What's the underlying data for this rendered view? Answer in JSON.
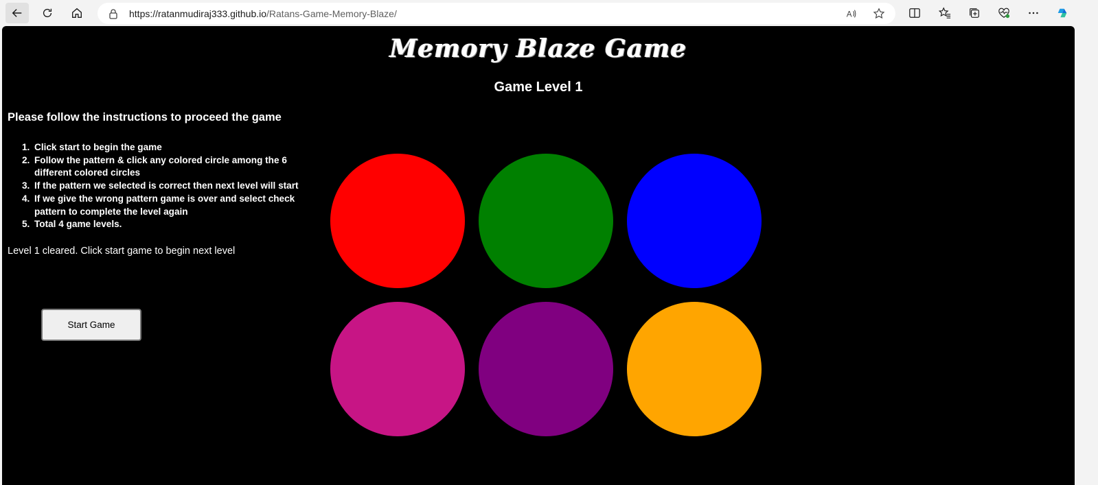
{
  "browser": {
    "url_host": "https://ratanmudiraj333.github.io",
    "url_path": "/Ratans-Game-Memory-Blaze/"
  },
  "page": {
    "title": "Memory Blaze Game",
    "level_heading": "Game Level 1",
    "instructions_heading": "Please follow the instructions to proceed the game",
    "instructions": [
      {
        "num": "1.",
        "text": "Click start to begin the game"
      },
      {
        "num": "2.",
        "text": "Follow the pattern & click any colored circle among the 6 different colored circles"
      },
      {
        "num": "3.",
        "text": "If the pattern we selected is correct then next level will start"
      },
      {
        "num": "4.",
        "text": "If we give the wrong pattern game is over and select check pattern to complete the level again"
      },
      {
        "num": "5.",
        "text": "Total 4 game levels."
      }
    ],
    "status_message": "Level 1 cleared. Click start game to begin next level",
    "start_button_label": "Start Game"
  },
  "circles": [
    {
      "name": "red",
      "color": "#ff0000"
    },
    {
      "name": "green",
      "color": "#008000"
    },
    {
      "name": "blue",
      "color": "#0000ff"
    },
    {
      "name": "magenta",
      "color": "#c71585"
    },
    {
      "name": "purple",
      "color": "#800080"
    },
    {
      "name": "orange",
      "color": "#ffa500"
    }
  ]
}
